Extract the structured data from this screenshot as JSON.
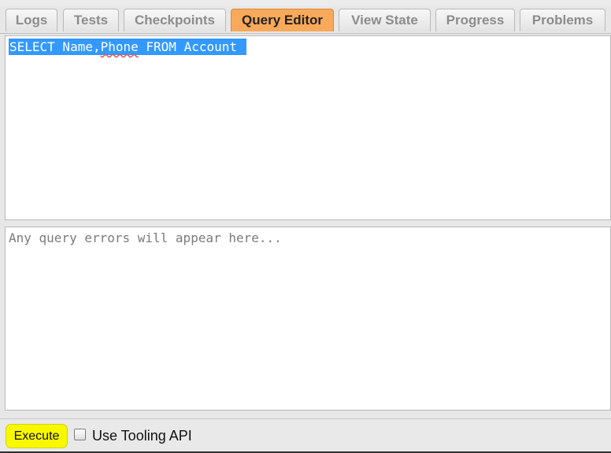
{
  "tabs": [
    {
      "label": "Logs",
      "active": false
    },
    {
      "label": "Tests",
      "active": false
    },
    {
      "label": "Checkpoints",
      "active": false
    },
    {
      "label": "Query Editor",
      "active": true
    },
    {
      "label": "View State",
      "active": false
    },
    {
      "label": "Progress",
      "active": false
    },
    {
      "label": "Problems",
      "active": false
    }
  ],
  "query_editor": {
    "query_part1": "SELECT Name,",
    "query_misspelled": "Phone",
    "query_part2": " FROM Account",
    "errors_placeholder": "Any query errors will appear here..."
  },
  "footer": {
    "execute_label": "Execute",
    "tooling_api_label": "Use Tooling API",
    "tooling_api_checked": false
  },
  "colors": {
    "active_tab": "#f9a95a",
    "selection": "#3399ff",
    "execute_highlight": "#f8f800"
  }
}
